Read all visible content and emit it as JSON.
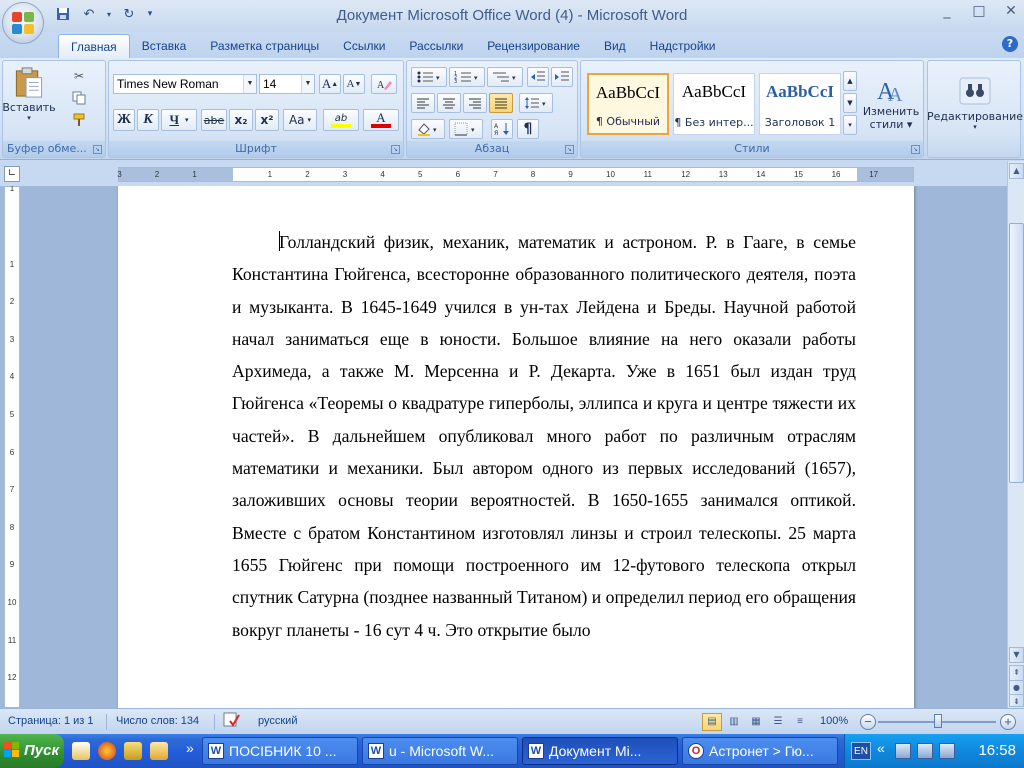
{
  "window": {
    "title": "Документ Microsoft Office Word (4) - Microsoft Word",
    "controls": [
      "_",
      "□",
      "✕"
    ]
  },
  "tabs": [
    "Главная",
    "Вставка",
    "Разметка страницы",
    "Ссылки",
    "Рассылки",
    "Рецензирование",
    "Вид",
    "Надстройки"
  ],
  "ribbon": {
    "clipboard": {
      "paste_label": "Вставить",
      "group_label": "Буфер обме..."
    },
    "font": {
      "font_name": "Times New Roman",
      "font_size": "14",
      "group_label": "Шрифт",
      "grow": "A",
      "shrink": "A",
      "bold": "Ж",
      "italic": "К",
      "underline": "Ч",
      "strike": "abe",
      "subscript": "x₂",
      "superscript": "x²",
      "case": "Aa",
      "highlight": "ab",
      "color": "A"
    },
    "paragraph": {
      "group_label": "Абзац",
      "pilcrow": "¶"
    },
    "styles": {
      "group_label": "Стили",
      "items": [
        {
          "sample": "AaBbCcI",
          "name": "¶ Обычный"
        },
        {
          "sample": "AaBbCcI",
          "name": "¶ Без интер..."
        },
        {
          "sample": "AaBbCcI",
          "name": "Заголовок 1"
        }
      ],
      "change_styles_line1": "Изменить",
      "change_styles_line2": "стили"
    },
    "editing": {
      "label": "Редактирование"
    }
  },
  "ruler": {
    "ticks": [
      "3",
      "2",
      "1",
      "1",
      "2",
      "3",
      "4",
      "5",
      "6",
      "7",
      "8",
      "9",
      "10",
      "11",
      "12",
      "13",
      "14",
      "15",
      "16",
      "17"
    ],
    "vticks": [
      "1",
      "1",
      "2",
      "3",
      "4",
      "5",
      "6",
      "7",
      "8",
      "9",
      "10",
      "11",
      "12"
    ]
  },
  "document": {
    "text": "Голландский физик, механик, математик и астроном. Р. в Гааге, в семье Константина Гюйгенса, всесторонне образованного политического деятеля, поэта и музыканта. В 1645-1649 учился в ун-тах Лейдена и Бреды. Научной работой начал заниматься еще в юности. Большое влияние на него оказали работы Архимеда, а также М. Мерсенна и Р. Декарта. Уже в 1651 был издан труд Гюйгенса «Теоремы о квадратуре гиперболы, эллипса и круга и центре тяжести их частей». В дальнейшем опубликовал много работ по различным отраслям математики и механики. Был автором одного из первых исследований (1657), заложивших основы теории вероятностей. В 1650-1655 занимался оптикой. Вместе с братом Константином изготовлял линзы и строил телескопы. 25 марта 1655 Гюйгенс при помощи построенного им 12-футового телескопа открыл спутник Сатурна (позднее названный Титаном) и определил период его обращения вокруг планеты - 16 сут 4 ч. Это открытие было"
  },
  "status": {
    "page": "Страница: 1 из 1",
    "words": "Число слов: 134",
    "language": "русский",
    "zoom": "100%",
    "zoom_minus": "−",
    "zoom_plus": "+"
  },
  "taskbar": {
    "start": "Пуск",
    "more": "»",
    "tasks": [
      {
        "label": "ПОСІБНИК 10 ...",
        "icon": "W",
        "active": false
      },
      {
        "label": "u - Microsoft W...",
        "icon": "W",
        "active": false
      },
      {
        "label": "Документ Mi...",
        "icon": "W",
        "active": true
      },
      {
        "label": "Астронет > Гю...",
        "icon": "O",
        "active": false
      }
    ],
    "lang": "EN",
    "tray_more": "«",
    "clock": "16:58"
  }
}
